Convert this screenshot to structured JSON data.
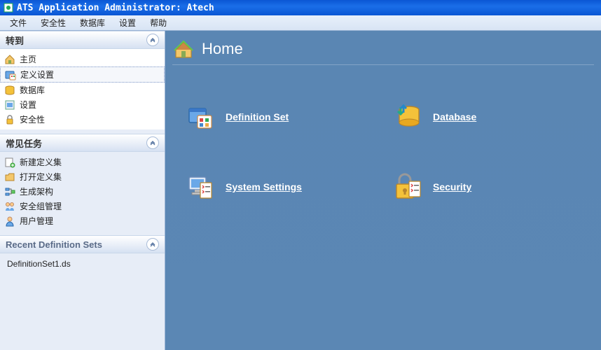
{
  "titlebar": {
    "title": "ATS Application Administrator: Atech"
  },
  "menubar": {
    "items": [
      "文件",
      "安全性",
      "数据库",
      "设置",
      "帮助"
    ]
  },
  "sidebar": {
    "panels": [
      {
        "title": "转到",
        "items": [
          {
            "label": "主页",
            "icon": "home"
          },
          {
            "label": "定义设置",
            "icon": "definition",
            "selected": true
          },
          {
            "label": "数据库",
            "icon": "database"
          },
          {
            "label": "设置",
            "icon": "settings"
          },
          {
            "label": "安全性",
            "icon": "security"
          }
        ]
      },
      {
        "title": "常见任务",
        "items": [
          {
            "label": "新建定义集",
            "icon": "new-def"
          },
          {
            "label": "打开定义集",
            "icon": "open-def"
          },
          {
            "label": "生成架构",
            "icon": "gen-schema"
          },
          {
            "label": "安全组管理",
            "icon": "group-mgmt"
          },
          {
            "label": "用户管理",
            "icon": "user-mgmt"
          }
        ]
      },
      {
        "title": "Recent Definition Sets",
        "recent": [
          "DefinitionSet1.ds"
        ]
      }
    ]
  },
  "content": {
    "title": "Home",
    "tiles": [
      {
        "label": "Definition Set",
        "icon": "definition-set"
      },
      {
        "label": "Database",
        "icon": "database-big"
      },
      {
        "label": "System Settings",
        "icon": "system-settings"
      },
      {
        "label": "Security",
        "icon": "security-big"
      }
    ]
  }
}
